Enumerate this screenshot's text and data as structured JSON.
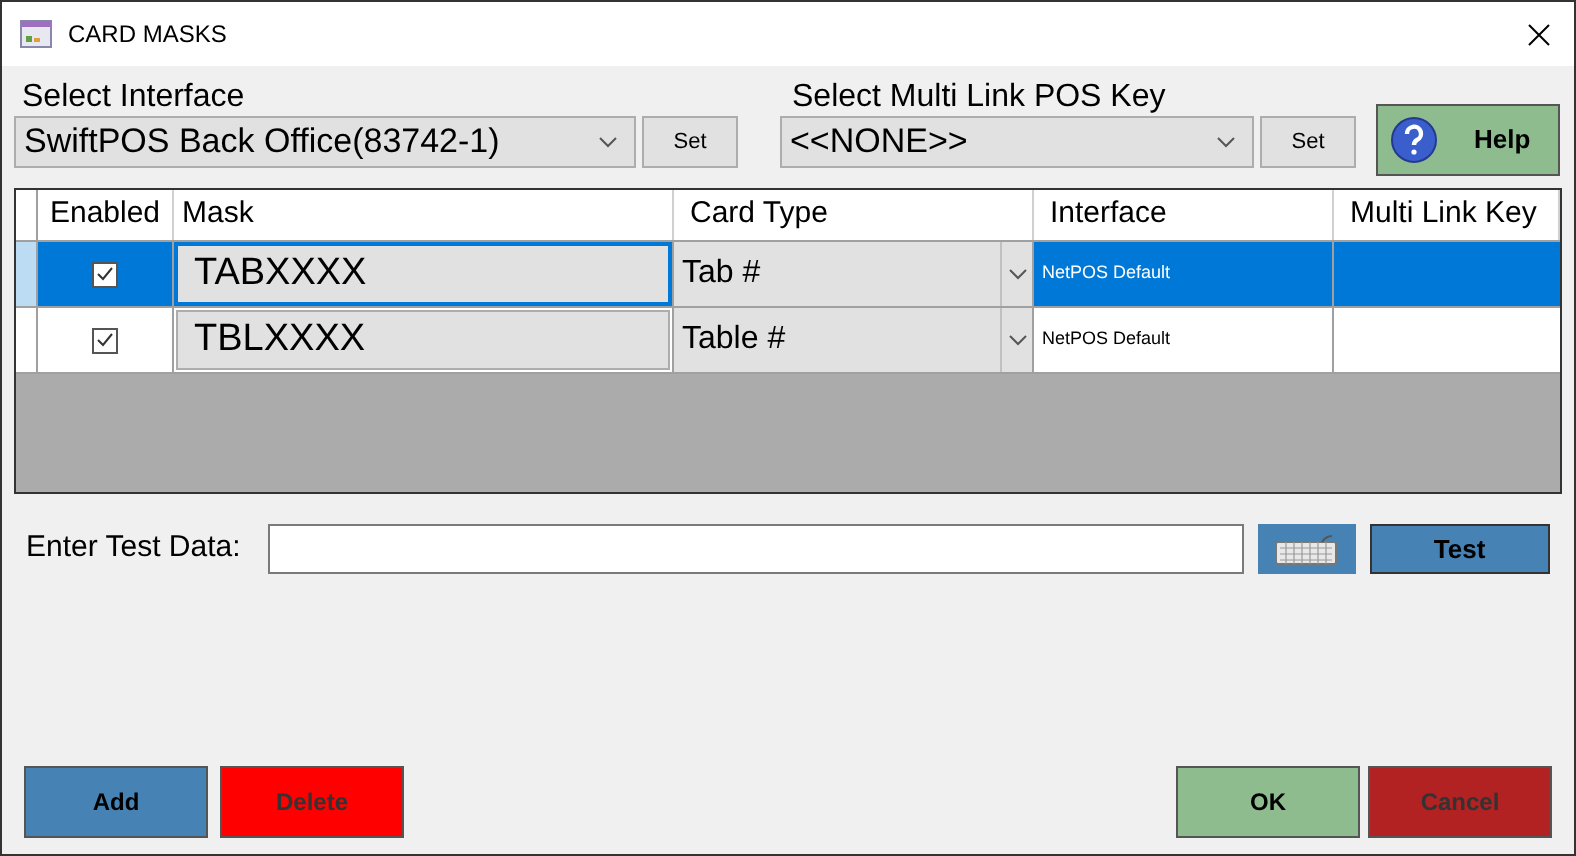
{
  "window": {
    "title": "CARD MASKS"
  },
  "interface_select": {
    "label": "Select Interface",
    "value": "SwiftPOS Back Office(83742-1)",
    "set_button": "Set"
  },
  "multi_link_select": {
    "label": "Select Multi Link POS Key",
    "value": "<<NONE>>",
    "set_button": "Set"
  },
  "help_button": "Help",
  "table": {
    "columns": [
      "Enabled",
      "Mask",
      "Card Type",
      "Interface",
      "Multi Link Key"
    ],
    "rows": [
      {
        "enabled": true,
        "mask": "TABXXXX",
        "card_type": "Tab #",
        "interface": "NetPOS Default",
        "selected": true
      },
      {
        "enabled": true,
        "mask": "TBLXXXX",
        "card_type": "Table #",
        "interface": "NetPOS Default",
        "selected": false
      }
    ]
  },
  "test_data": {
    "label": "Enter Test Data:",
    "test_button": "Test"
  },
  "buttons": {
    "add": "Add",
    "delete": "Delete",
    "ok": "OK",
    "cancel": "Cancel"
  }
}
